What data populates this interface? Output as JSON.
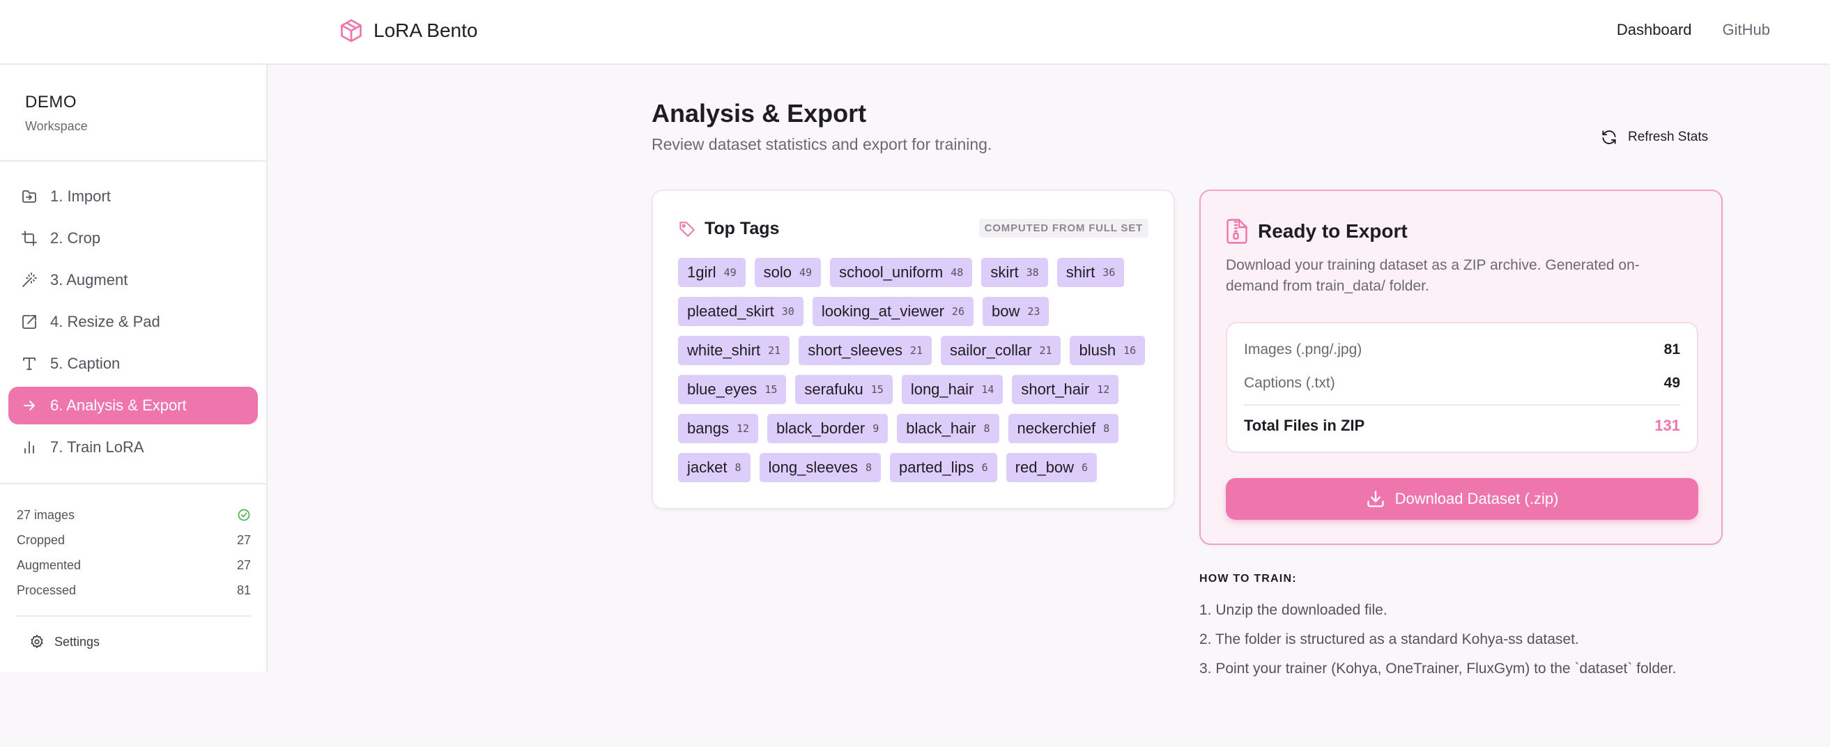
{
  "header": {
    "brand": "LoRA Bento",
    "nav": [
      {
        "label": "Dashboard"
      },
      {
        "label": "GitHub"
      }
    ]
  },
  "sidebar": {
    "workspace_name": "DEMO",
    "workspace_sub": "Workspace",
    "items": [
      {
        "label": "1. Import",
        "icon": "import-icon"
      },
      {
        "label": "2. Crop",
        "icon": "crop-icon"
      },
      {
        "label": "3. Augment",
        "icon": "magic-wand-icon"
      },
      {
        "label": "4. Resize & Pad",
        "icon": "resize-icon"
      },
      {
        "label": "5. Caption",
        "icon": "text-icon"
      },
      {
        "label": "6. Analysis & Export",
        "icon": "arrow-right-icon",
        "active": true
      },
      {
        "label": "7. Train LoRA",
        "icon": "bar-chart-icon"
      }
    ],
    "stats": {
      "images_label": "27 images",
      "rows": [
        {
          "label": "Cropped",
          "value": "27"
        },
        {
          "label": "Augmented",
          "value": "27"
        },
        {
          "label": "Processed",
          "value": "81"
        }
      ]
    },
    "settings_label": "Settings"
  },
  "main": {
    "title": "Analysis & Export",
    "subtitle": "Review dataset statistics and export for training.",
    "refresh_label": "Refresh Stats",
    "top_tags": {
      "title": "Top Tags",
      "badge": "COMPUTED FROM FULL SET",
      "tags": [
        {
          "name": "1girl",
          "count": "49"
        },
        {
          "name": "solo",
          "count": "49"
        },
        {
          "name": "school_uniform",
          "count": "48"
        },
        {
          "name": "skirt",
          "count": "38"
        },
        {
          "name": "shirt",
          "count": "36"
        },
        {
          "name": "pleated_skirt",
          "count": "30"
        },
        {
          "name": "looking_at_viewer",
          "count": "26"
        },
        {
          "name": "bow",
          "count": "23"
        },
        {
          "name": "white_shirt",
          "count": "21"
        },
        {
          "name": "short_sleeves",
          "count": "21"
        },
        {
          "name": "sailor_collar",
          "count": "21"
        },
        {
          "name": "blush",
          "count": "16"
        },
        {
          "name": "blue_eyes",
          "count": "15"
        },
        {
          "name": "serafuku",
          "count": "15"
        },
        {
          "name": "long_hair",
          "count": "14"
        },
        {
          "name": "short_hair",
          "count": "12"
        },
        {
          "name": "bangs",
          "count": "12"
        },
        {
          "name": "black_border",
          "count": "9"
        },
        {
          "name": "black_hair",
          "count": "8"
        },
        {
          "name": "neckerchief",
          "count": "8"
        },
        {
          "name": "jacket",
          "count": "8"
        },
        {
          "name": "long_sleeves",
          "count": "8"
        },
        {
          "name": "parted_lips",
          "count": "6"
        },
        {
          "name": "red_bow",
          "count": "6"
        }
      ]
    },
    "export": {
      "title": "Ready to Export",
      "description": "Download your training dataset as a ZIP archive. Generated on-demand from train_data/ folder.",
      "images_label": "Images (.png/.jpg)",
      "images_value": "81",
      "captions_label": "Captions (.txt)",
      "captions_value": "49",
      "total_label": "Total Files in ZIP",
      "total_value": "131",
      "download_label": "Download Dataset (.zip)"
    },
    "howto": {
      "title": "HOW TO TRAIN:",
      "steps": [
        "1. Unzip the downloaded file.",
        "2. The folder is structured as a standard Kohya-ss dataset.",
        "3. Point your trainer (Kohya, OneTrainer, FluxGym) to the `dataset` folder."
      ]
    }
  },
  "colors": {
    "accent": "#ee76ad",
    "tag_bg": "#dccdfa",
    "success": "#4caf50"
  }
}
